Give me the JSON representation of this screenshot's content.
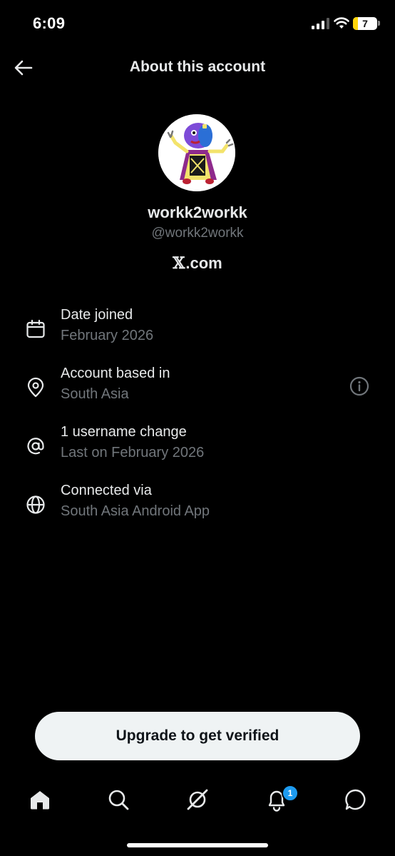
{
  "status_bar": {
    "time": "6:09",
    "battery_level": "7"
  },
  "header": {
    "title": "About this account"
  },
  "profile": {
    "display_name": "workk2workk",
    "handle": "@workk2workk",
    "site_prefix": "𝕏",
    "site_suffix": ".com"
  },
  "info_rows": [
    {
      "label": "Date joined",
      "value": "February 2026",
      "icon": "calendar-icon"
    },
    {
      "label": "Account based in",
      "value": "South Asia",
      "icon": "location-pin-icon"
    },
    {
      "label": "1 username change",
      "value": "Last on February 2026",
      "icon": "at-sign-icon"
    },
    {
      "label": "Connected via",
      "value": "South Asia Android App",
      "icon": "globe-icon"
    }
  ],
  "upgrade_button": {
    "label": "Upgrade to get verified"
  },
  "tab_bar": {
    "items": [
      "home-icon",
      "search-icon",
      "grok-icon",
      "notifications-icon",
      "messages-icon"
    ],
    "notification_count": "1"
  },
  "colors": {
    "background": "#000000",
    "primary_text": "#e7e9ea",
    "secondary_text": "#71767b",
    "accent": "#1d9bf0"
  }
}
